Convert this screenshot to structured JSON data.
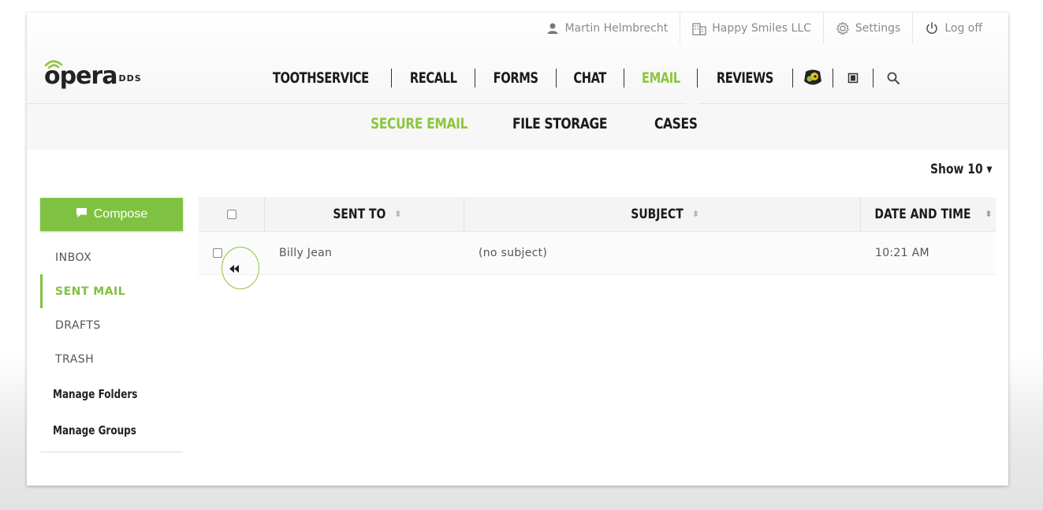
{
  "header": {
    "user_name": "Martin Helmbrecht",
    "company": "Happy Smiles LLC",
    "settings_label": "Settings",
    "logoff_label": "Log off",
    "logo_text": "opera",
    "logo_sub": "DDS"
  },
  "nav": {
    "toothservice": "TOOTHSERVICE",
    "recall": "RECALL",
    "forms": "FORMS",
    "chat": "CHAT",
    "email": "EMAIL",
    "reviews": "REVIEWS"
  },
  "subnav": {
    "secure_email": "SECURE EMAIL",
    "file_storage": "FILE STORAGE",
    "cases": "CASES"
  },
  "toolbar": {
    "show_label": "Show 10 ▾"
  },
  "sidebar": {
    "compose_label": "Compose",
    "folders": [
      "INBOX",
      "SENT MAIL",
      "DRAFTS",
      "TRASH"
    ],
    "manage_folders": "Manage Folders",
    "manage_groups": "Manage Groups"
  },
  "table": {
    "columns": [
      "SENT TO",
      "SUBJECT",
      "DATE AND TIME"
    ],
    "rows": [
      {
        "sent_to": "Billy Jean",
        "subject": "(no subject)",
        "date_time": "10:21 AM"
      }
    ]
  },
  "colors": {
    "accent": "#8cc63f",
    "compose_bg": "#7fc241"
  },
  "icons": {
    "user": "user-icon",
    "company": "building-icon",
    "settings": "gear-icon",
    "logoff": "power-icon",
    "mascot": "mascot-icon",
    "phone": "phone-icon",
    "search": "search-icon",
    "compose": "speech-bubble-icon",
    "replied": "double-chevron-left-icon"
  }
}
